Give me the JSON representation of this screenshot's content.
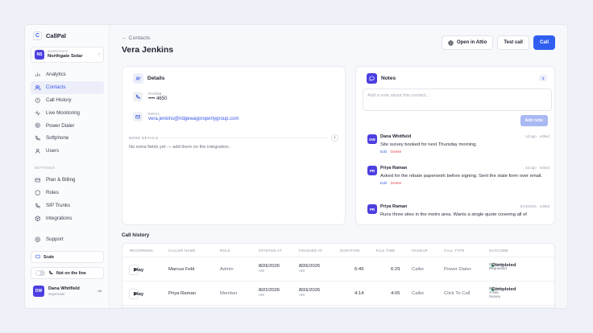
{
  "brand": {
    "name": "CallPal",
    "logo_glyph": "C"
  },
  "workspace": {
    "label": "WORKSPACE",
    "name": "Northgate Solar",
    "initials": "NS"
  },
  "nav": [
    {
      "label": "Analytics",
      "icon": "bar-chart-icon",
      "active": false
    },
    {
      "label": "Contacts",
      "icon": "people-icon",
      "active": true
    },
    {
      "label": "Call History",
      "icon": "history-icon",
      "active": false
    },
    {
      "label": "Live Monitoring",
      "icon": "pulse-icon",
      "active": false
    },
    {
      "label": "Power Dialer",
      "icon": "target-icon",
      "active": false
    },
    {
      "label": "Softphone",
      "icon": "phone-icon",
      "active": false
    },
    {
      "label": "Users",
      "icon": "user-icon",
      "active": false
    }
  ],
  "settings_label": "SETTINGS",
  "settings_nav": [
    {
      "label": "Plan & Billing",
      "icon": "card-icon"
    },
    {
      "label": "Roles",
      "icon": "shield-icon"
    },
    {
      "label": "SIP Trunks",
      "icon": "phone-icon"
    },
    {
      "label": "Integrations",
      "icon": "cube-icon"
    }
  ],
  "support": {
    "label": "Support",
    "icon": "help-circle-icon"
  },
  "plan": {
    "label": "Scale"
  },
  "presence": {
    "label": "Not on the line"
  },
  "user": {
    "name": "Dana Whitfield",
    "role": "Superuser",
    "initials": "DW"
  },
  "header": {
    "back_label": "← Contacts",
    "title": "Vera Jenkins",
    "open_attio": "Open in Attio",
    "test_call": "Test call",
    "call": "Call"
  },
  "details": {
    "title": "Details",
    "phone_label": "PHONE",
    "phone_value": "•••• 4650",
    "email_label": "EMAIL",
    "email_value": "vera.jenkins@ridgewaypropertygroup.com",
    "more_label": "MORE DETAILS",
    "more_empty": "No extra fields yet — add them on the integration."
  },
  "notes": {
    "title": "Notes",
    "count": "3",
    "placeholder": "Add a note about this contact...",
    "add_label": "Add note",
    "items": [
      {
        "initials": "DW",
        "author": "Dana Whitfield",
        "meta": "1d ago · edited",
        "text": "Site survey booked for next Thursday morning.",
        "edit": "Edit",
        "delete": "Delete"
      },
      {
        "initials": "PR",
        "author": "Priya Raman",
        "meta": "4d ago · edited",
        "text": "Asked for the rebate paperwork before signing. Sent the state form over email.",
        "edit": "Edit",
        "delete": "Delete"
      },
      {
        "initials": "PR",
        "author": "Priya Raman",
        "meta": "8/13/2026 · edited",
        "text": "Runs three sites in the metro area. Wants a single quote covering all of"
      }
    ]
  },
  "call_history": {
    "title": "Call history",
    "columns": [
      "RECORDING",
      "CALLER NAME",
      "ROLE",
      "STARTED AT",
      "FINISHED AT",
      "DURATION",
      "TALK TIME",
      "HANGUP",
      "CALL TYPE",
      "OUTCOME"
    ],
    "rows": [
      {
        "play": "Play",
        "caller": "Marcus Feld",
        "role": "Admin",
        "start_date": "8/21/2026",
        "start_time": "10:28 AM",
        "end_date": "8/21/2026",
        "end_time": "10:35 AM",
        "duration": "6:45",
        "talk": "6:29",
        "hangup": "Caller",
        "type": "Power Dialer",
        "status": "Completed",
        "outcome": "Callback Requested"
      },
      {
        "play": "Play",
        "caller": "Priya Raman",
        "role": "Member",
        "start_date": "8/21/2026",
        "start_time": "10:12 AM",
        "end_date": "8/21/2026",
        "end_time": "10:16 AM",
        "duration": "4:14",
        "talk": "4:05",
        "hangup": "Caller",
        "type": "Click To Call",
        "status": "Completed",
        "outcome": "Booked A Site Survey"
      }
    ]
  }
}
